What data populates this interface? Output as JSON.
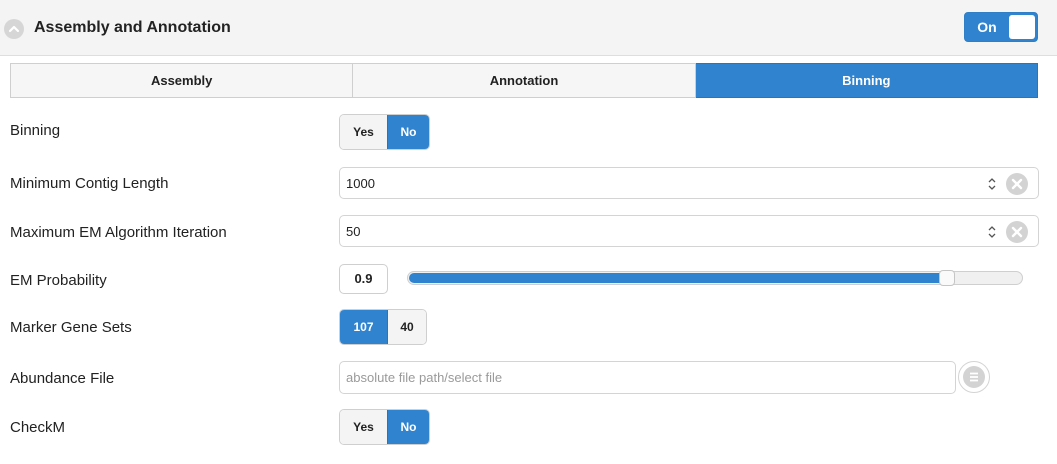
{
  "header": {
    "title": "Assembly and Annotation",
    "toggle_label": "On",
    "toggle_on": true
  },
  "tabs": [
    {
      "label": "Assembly",
      "active": false
    },
    {
      "label": "Annotation",
      "active": false
    },
    {
      "label": "Binning",
      "active": true
    }
  ],
  "binning": {
    "label": "Binning",
    "options": [
      "Yes",
      "No"
    ],
    "selected": "No"
  },
  "min_contig": {
    "label": "Minimum Contig Length",
    "value": "1000"
  },
  "max_em": {
    "label": "Maximum EM Algorithm Iteration",
    "value": "50"
  },
  "em_probability": {
    "label": "EM Probability",
    "value": "0.9",
    "slider_fraction": 0.9
  },
  "marker_gene_sets": {
    "label": "Marker Gene Sets",
    "options": [
      "107",
      "40"
    ],
    "selected": "107"
  },
  "abundance_file": {
    "label": "Abundance File",
    "placeholder": "absolute file path/select file",
    "value": ""
  },
  "checkm": {
    "label": "CheckM",
    "options": [
      "Yes",
      "No"
    ],
    "selected": "No"
  },
  "colors": {
    "accent": "#2f83cf",
    "header_bg": "#f4f4f4",
    "border": "#cfcfcf"
  },
  "icons": {
    "collapse": "chevron-up-circle-icon",
    "clear": "clear-circle-x-icon",
    "spinner": "number-spinner-icon",
    "browse": "list-browse-icon"
  }
}
